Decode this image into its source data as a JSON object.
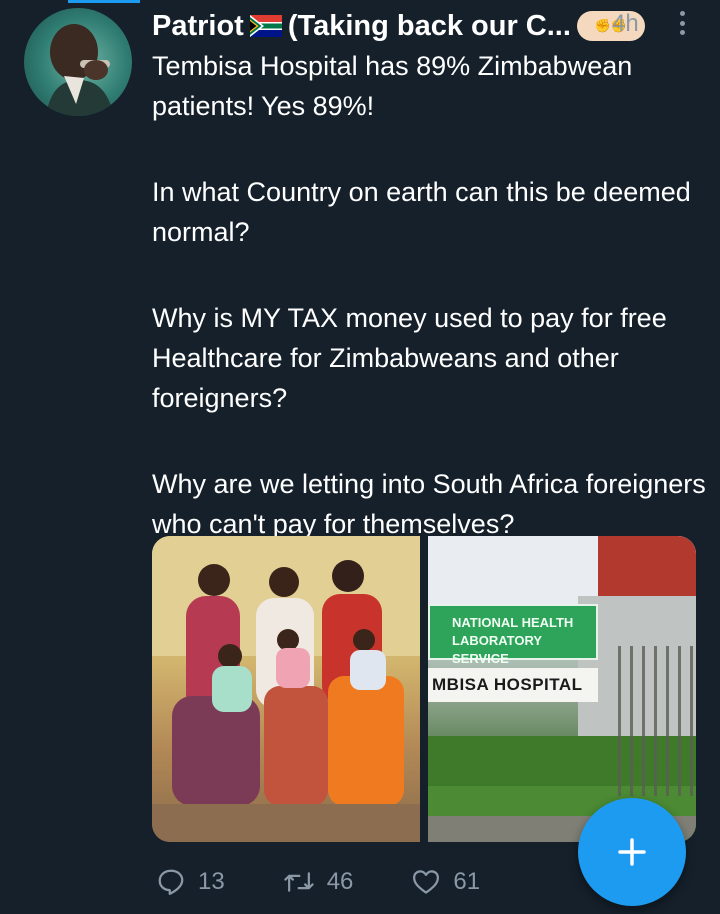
{
  "tweet": {
    "display_name": "Patriot",
    "name_suffix": "(Taking back our C...",
    "timestamp": "4h",
    "paragraphs": [
      "Tembisa Hospital has 89% Zimbabwean patients! Yes 89%!",
      "In what Country on earth can this be deemed normal?",
      "Why is MY TAX money used to pay for free Healthcare for Zimbabweans and other foreigners?",
      "Why are we letting into South Africa foreigners who can't pay for themselves?"
    ],
    "media": {
      "right_sign_top": [
        "NATIONAL HEALTH",
        "LABORATORY SERVICE"
      ],
      "right_sign_bottom": "MBISA HOSPITAL"
    },
    "actions": {
      "replies": "13",
      "retweets": "46",
      "likes": "61"
    }
  },
  "icons": {
    "flag": "south-africa-flag-icon",
    "fist": "raised-fist-icon",
    "more": "more-vertical-icon",
    "reply": "reply-icon",
    "retweet": "retweet-icon",
    "like": "heart-icon",
    "compose": "plus-icon"
  },
  "colors": {
    "background": "#15202b",
    "accent": "#1d9bf0",
    "muted": "#8b98a5"
  }
}
